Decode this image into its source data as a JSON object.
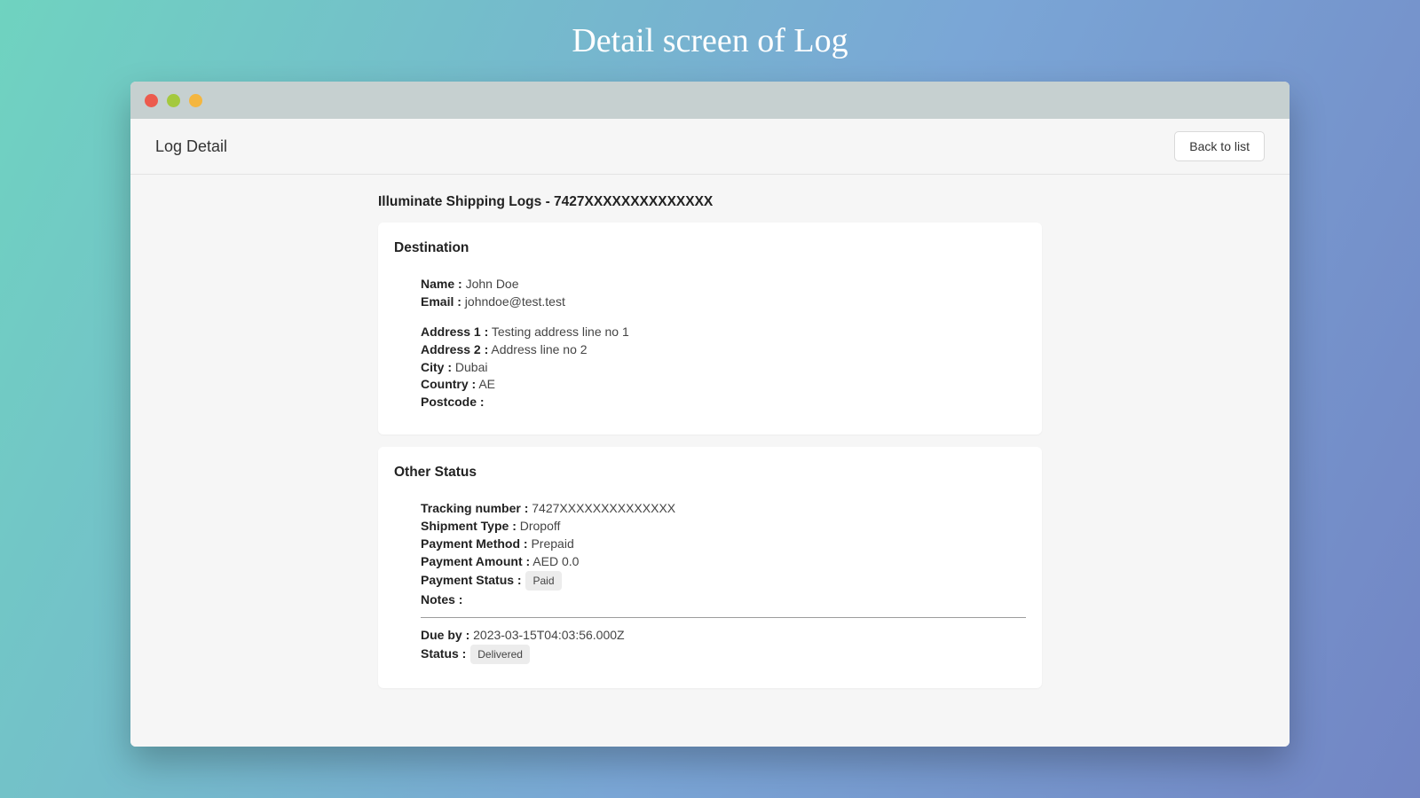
{
  "page": {
    "caption": "Detail screen of Log"
  },
  "header": {
    "title": "Log Detail",
    "back_label": "Back to list"
  },
  "record": {
    "title": "Illuminate Shipping Logs - 7427XXXXXXXXXXXXXX"
  },
  "destination": {
    "heading": "Destination",
    "labels": {
      "name": "Name :",
      "email": "Email :",
      "address1": "Address 1 :",
      "address2": "Address 2 :",
      "city": "City :",
      "country": "Country :",
      "postcode": "Postcode :"
    },
    "values": {
      "name": "John Doe",
      "email": "johndoe@test.test",
      "address1": "Testing address line no 1",
      "address2": "Address line no 2",
      "city": "Dubai",
      "country": "AE",
      "postcode": ""
    }
  },
  "status": {
    "heading": "Other Status",
    "labels": {
      "tracking": "Tracking number :",
      "shipment_type": "Shipment Type :",
      "payment_method": "Payment Method :",
      "payment_amount": "Payment Amount :",
      "payment_status": "Payment Status :",
      "notes": "Notes :",
      "due_by": "Due by :",
      "status": "Status :"
    },
    "values": {
      "tracking": "7427XXXXXXXXXXXXXX",
      "shipment_type": "Dropoff",
      "payment_method": "Prepaid",
      "payment_amount": "AED 0.0",
      "payment_status": "Paid",
      "notes": "",
      "due_by": "2023-03-15T04:03:56.000Z",
      "status": "Delivered"
    }
  }
}
